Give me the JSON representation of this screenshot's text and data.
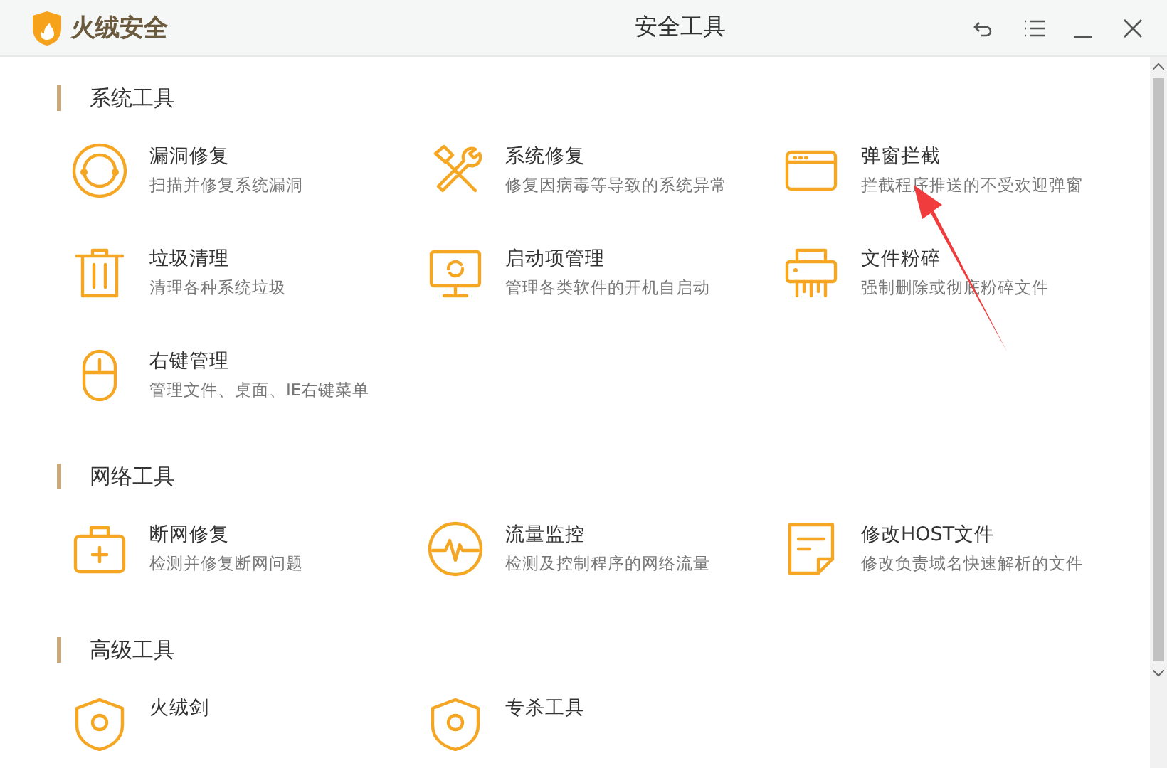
{
  "window": {
    "app_name": "火绒安全",
    "title": "安全工具"
  },
  "sections": [
    {
      "title": "系统工具",
      "items": [
        {
          "kind": "bug",
          "name": "漏洞修复",
          "desc": "扫描并修复系统漏洞"
        },
        {
          "kind": "repair",
          "name": "系统修复",
          "desc": "修复因病毒等导致的系统异常"
        },
        {
          "kind": "popup",
          "name": "弹窗拦截",
          "desc": "拦截程序推送的不受欢迎弹窗"
        },
        {
          "kind": "trash",
          "name": "垃圾清理",
          "desc": "清理各种系统垃圾"
        },
        {
          "kind": "startup",
          "name": "启动项管理",
          "desc": "管理各类软件的开机自启动"
        },
        {
          "kind": "shredder",
          "name": "文件粉碎",
          "desc": "强制删除或彻底粉碎文件"
        },
        {
          "kind": "mouse",
          "name": "右键管理",
          "desc": "管理文件、桌面、IE右键菜单"
        }
      ]
    },
    {
      "title": "网络工具",
      "items": [
        {
          "kind": "kit",
          "name": "断网修复",
          "desc": "检测并修复断网问题"
        },
        {
          "kind": "traffic",
          "name": "流量监控",
          "desc": "检测及控制程序的网络流量"
        },
        {
          "kind": "note",
          "name": "修改HOST文件",
          "desc": "修改负责域名快速解析的文件"
        }
      ]
    },
    {
      "title": "高级工具",
      "items": [
        {
          "kind": "shield",
          "name": "火绒剑"
        },
        {
          "kind": "shield",
          "name": "专杀工具"
        }
      ]
    }
  ]
}
